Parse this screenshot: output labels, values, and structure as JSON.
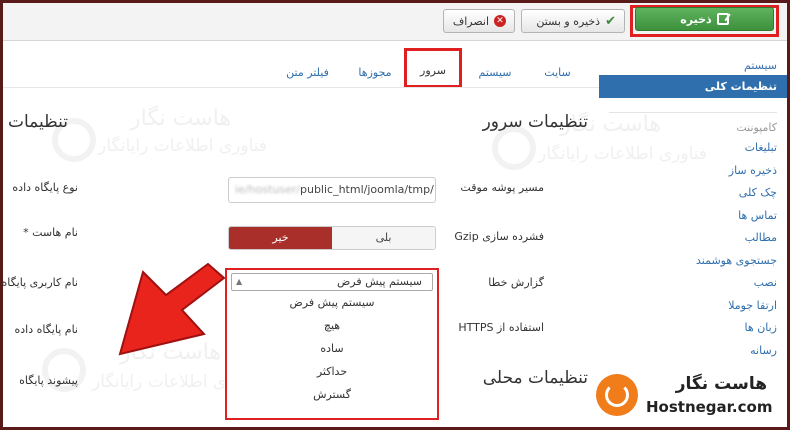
{
  "toolbar": {
    "save_label": "ذخیره",
    "save_close_label": "ذخیره و بستن",
    "cancel_label": "انصراف"
  },
  "sidebar": {
    "system_header": "سیستم",
    "active_item": "تنظیمات کلی",
    "component_header": "کامپوننت",
    "items": [
      {
        "label": "تبلیغات"
      },
      {
        "label": "ذخیره ساز"
      },
      {
        "label": "چک کلی"
      },
      {
        "label": "تماس ها"
      },
      {
        "label": "مطالب"
      },
      {
        "label": "جستجوی هوشمند"
      },
      {
        "label": "نصب"
      },
      {
        "label": "ارتقا جوملا"
      },
      {
        "label": "زبان ها"
      },
      {
        "label": "رسانه"
      }
    ]
  },
  "tabs": [
    {
      "label": "سایت"
    },
    {
      "label": "سیستم"
    },
    {
      "label": "سرور"
    },
    {
      "label": "مجوزها"
    },
    {
      "label": "فیلتر متن"
    }
  ],
  "main": {
    "server_settings_title": "تنظیمات سرور",
    "locale_settings_title": "تنظیمات محلی",
    "database_settings_title": "تنظیمات",
    "temp_path_label": "مسیر پوشه موقت",
    "temp_path_prefix": "ie/hostuser/",
    "temp_path_value": "public_html/joomla/tmp/",
    "gzip_label": "فشرده سازی Gzip",
    "gzip_on": "بلی",
    "gzip_off": "خیر",
    "error_report_label": "گزارش خطا",
    "https_label": "استفاده از HTTPS",
    "db_type_label": "نوع پایگاه داده",
    "host_label": "نام هاست *",
    "db_user_label": "نام کاربری پایگاه",
    "db_name_label": "نام پایگاه داده",
    "db_prefix_label": "پیشوند پایگاه"
  },
  "error_dropdown": {
    "selected": "سیستم پیش فرض",
    "options": [
      "سیستم پیش فرض",
      "هیچ",
      "ساده",
      "حداکثر",
      "گسترش"
    ]
  },
  "watermark": {
    "title": "هاست نگار",
    "subtitle": "فناوری اطلاعات رایانگار"
  },
  "brand": {
    "name_fa": "هاست نگار",
    "name_en": "Hostnegar.com"
  },
  "colors": {
    "save_green": "#47a447",
    "active_blue": "#2f6fad",
    "highlight_red": "#e02020",
    "toggle_off": "#a9302a",
    "brand_orange": "#f07c1a"
  }
}
